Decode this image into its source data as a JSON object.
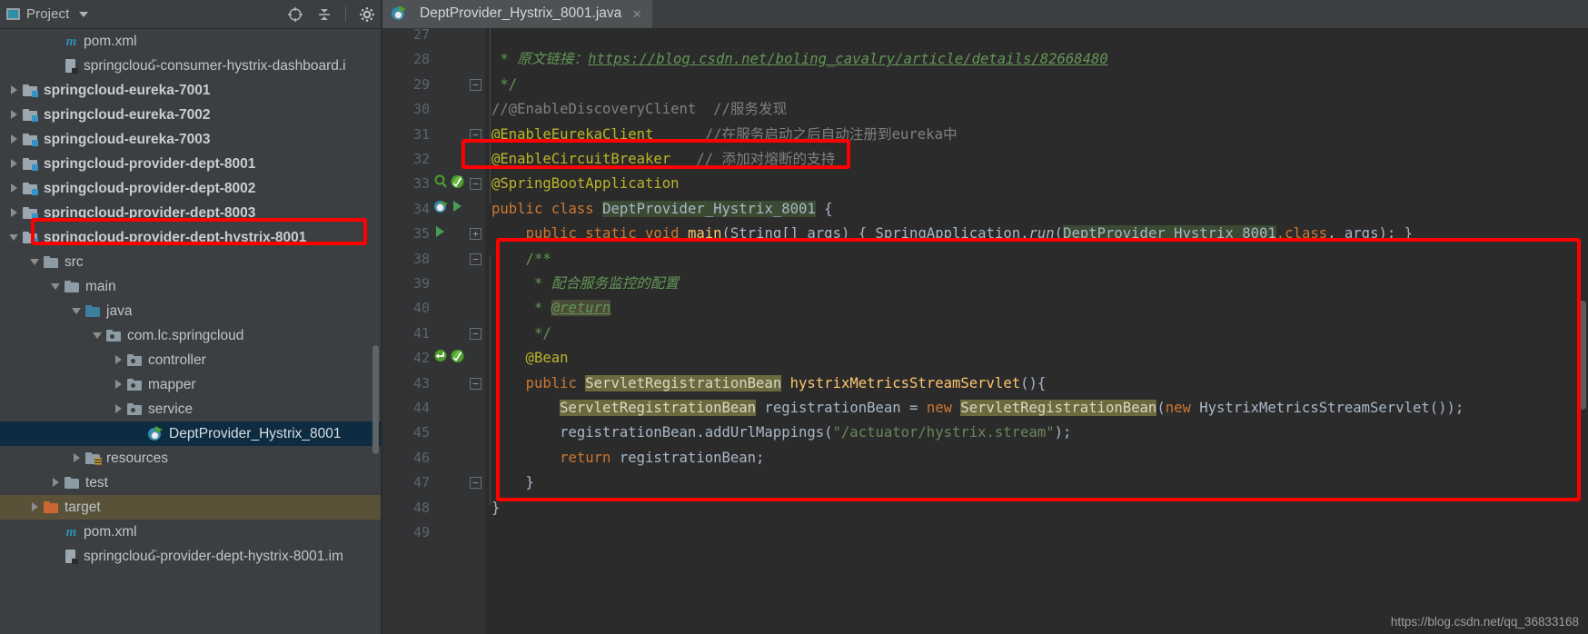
{
  "window": {
    "tool_window_title": "Project",
    "watermark": "https://blog.csdn.net/qq_36833168"
  },
  "toolbar": {
    "locate_icon": "crosshair-locate-icon",
    "collapse_icon": "collapse-all-icon",
    "settings_icon": "gear-icon",
    "hide_icon": "minimize-icon"
  },
  "sidebar": {
    "items": [
      {
        "label": "pom.xml",
        "icon": "maven-icon",
        "indent": 2,
        "arrow": "none",
        "style": "normal",
        "clipped": false
      },
      {
        "label": "springcloud-consumer-hystrix-dashboard.i",
        "icon": "iml-icon",
        "indent": 2,
        "arrow": "none",
        "style": "normal",
        "clipped": true
      },
      {
        "label": "springcloud-eureka-7001",
        "icon": "module-icon",
        "indent": 0,
        "arrow": "right",
        "style": "bold"
      },
      {
        "label": "springcloud-eureka-7002",
        "icon": "module-icon",
        "indent": 0,
        "arrow": "right",
        "style": "bold"
      },
      {
        "label": "springcloud-eureka-7003",
        "icon": "module-icon",
        "indent": 0,
        "arrow": "right",
        "style": "bold"
      },
      {
        "label": "springcloud-provider-dept-8001",
        "icon": "module-icon",
        "indent": 0,
        "arrow": "right",
        "style": "bold"
      },
      {
        "label": "springcloud-provider-dept-8002",
        "icon": "module-icon",
        "indent": 0,
        "arrow": "right",
        "style": "bold"
      },
      {
        "label": "springcloud-provider-dept-8003",
        "icon": "module-icon",
        "indent": 0,
        "arrow": "right",
        "style": "bold"
      },
      {
        "label": "springcloud-provider-dept-hystrix-8001",
        "icon": "module-icon",
        "indent": 0,
        "arrow": "down",
        "style": "bold",
        "highlight": "red-box"
      },
      {
        "label": "src",
        "icon": "folder-icon",
        "indent": 1,
        "arrow": "down",
        "style": "normal"
      },
      {
        "label": "main",
        "icon": "folder-icon",
        "indent": 2,
        "arrow": "down",
        "style": "normal"
      },
      {
        "label": "java",
        "icon": "folder-blue-icon",
        "indent": 3,
        "arrow": "down",
        "style": "normal"
      },
      {
        "label": "com.lc.springcloud",
        "icon": "package-icon",
        "indent": 4,
        "arrow": "down",
        "style": "normal"
      },
      {
        "label": "controller",
        "icon": "package-icon",
        "indent": 5,
        "arrow": "right",
        "style": "normal"
      },
      {
        "label": "mapper",
        "icon": "package-icon",
        "indent": 5,
        "arrow": "right",
        "style": "normal"
      },
      {
        "label": "service",
        "icon": "package-icon",
        "indent": 5,
        "arrow": "right",
        "style": "normal"
      },
      {
        "label": "DeptProvider_Hystrix_8001",
        "icon": "spring-class-icon",
        "indent": 6,
        "arrow": "none",
        "style": "normal",
        "selected": true
      },
      {
        "label": "resources",
        "icon": "resources-folder-icon",
        "indent": 3,
        "arrow": "right",
        "style": "normal"
      },
      {
        "label": "test",
        "icon": "folder-icon",
        "indent": 2,
        "arrow": "right",
        "style": "normal"
      },
      {
        "label": "target",
        "icon": "folder-orange-icon",
        "indent": 1,
        "arrow": "right",
        "style": "normal",
        "row_highlight": true
      },
      {
        "label": "pom.xml",
        "icon": "maven-icon",
        "indent": 2,
        "arrow": "none",
        "style": "normal"
      },
      {
        "label": "springcloud-provider-dept-hystrix-8001.im",
        "icon": "iml-icon",
        "indent": 2,
        "arrow": "none",
        "style": "normal",
        "clipped": true
      }
    ]
  },
  "editor": {
    "tab": {
      "title": "DeptProvider_Hystrix_8001.java",
      "icon": "spring-class-icon",
      "close": "×"
    },
    "lines": [
      {
        "num": "27",
        "text": "",
        "partial": true
      },
      {
        "num": "28",
        "segments": [
          {
            "t": " * ",
            "c": "jdoc"
          },
          {
            "t": "原文链接：",
            "c": "jdoc-i"
          },
          {
            "t": "https://blog.csdn.net/boling_cavalry/article/details/82668480",
            "c": "link"
          }
        ]
      },
      {
        "num": "29",
        "fold": "minus",
        "segments": [
          {
            "t": " */",
            "c": "jdoc"
          }
        ]
      },
      {
        "num": "30",
        "segments": [
          {
            "t": "//@EnableDiscoveryClient  //服务发现",
            "c": "cmt"
          }
        ]
      },
      {
        "num": "31",
        "fold": "minus",
        "segments": [
          {
            "t": "@EnableEurekaClient",
            "c": "anno"
          },
          {
            "t": "      //在服务启动之后自动注册到eureka中",
            "c": "cmt"
          }
        ]
      },
      {
        "num": "32",
        "segments": [
          {
            "t": "@EnableCircuitBreaker",
            "c": "anno"
          },
          {
            "t": "   // 添加对熔断的支持",
            "c": "cmt"
          }
        ]
      },
      {
        "num": "33",
        "gutter_icons": [
          "bean-search-icon",
          "spring-bean-icon"
        ],
        "fold": "minus",
        "segments": [
          {
            "t": "@SpringBootApplication",
            "c": "anno"
          }
        ]
      },
      {
        "num": "34",
        "gutter_icons": [
          "spring-class-icon",
          "run-icon"
        ],
        "segments": [
          {
            "t": "public ",
            "c": "kw"
          },
          {
            "t": "class ",
            "c": "kw"
          },
          {
            "t": "DeptProvider_Hystrix_8001",
            "c": "clsname"
          },
          {
            "t": " {",
            "c": "id"
          }
        ]
      },
      {
        "num": "35",
        "gutter_icons": [
          "run-icon"
        ],
        "fold": "plus",
        "segments": [
          {
            "t": "    ",
            "c": "id"
          },
          {
            "t": "public static void ",
            "c": "kw"
          },
          {
            "t": "main",
            "c": "meth"
          },
          {
            "t": "(String[] args) { SpringApplication.",
            "c": "id"
          },
          {
            "t": "run",
            "c": "methi"
          },
          {
            "t": "(",
            "c": "id"
          },
          {
            "t": "DeptProvider_Hystrix_8001",
            "c": "clsname"
          },
          {
            "t": ".class",
            "c": "kw"
          },
          {
            "t": ", args); }",
            "c": "id"
          }
        ]
      },
      {
        "num": "38",
        "fold": "minus",
        "segments": [
          {
            "t": "    /**",
            "c": "jdoc"
          }
        ]
      },
      {
        "num": "39",
        "segments": [
          {
            "t": "     * ",
            "c": "jdoc"
          },
          {
            "t": "配合服务监控的配置",
            "c": "jdoc-i"
          }
        ]
      },
      {
        "num": "40",
        "segments": [
          {
            "t": "     * ",
            "c": "jdoc"
          },
          {
            "t": "@return",
            "c": "jdoc-tag"
          }
        ]
      },
      {
        "num": "41",
        "fold": "minus",
        "segments": [
          {
            "t": "     */",
            "c": "jdoc"
          }
        ]
      },
      {
        "num": "42",
        "gutter_icons": [
          "override-icon",
          "spring-bean-icon"
        ],
        "segments": [
          {
            "t": "    @Bean",
            "c": "anno"
          }
        ]
      },
      {
        "num": "43",
        "fold": "minus",
        "segments": [
          {
            "t": "    ",
            "c": "id"
          },
          {
            "t": "public ",
            "c": "kw"
          },
          {
            "t": "ServletRegistrationBean",
            "c": "typ"
          },
          {
            "t": " ",
            "c": "id"
          },
          {
            "t": "hystrixMetricsStreamServlet",
            "c": "meth"
          },
          {
            "t": "(){",
            "c": "id"
          }
        ]
      },
      {
        "num": "44",
        "segments": [
          {
            "t": "        ",
            "c": "id"
          },
          {
            "t": "ServletRegistrationBean",
            "c": "typ"
          },
          {
            "t": " registrationBean = ",
            "c": "id"
          },
          {
            "t": "new ",
            "c": "kw"
          },
          {
            "t": "ServletRegistrationBean",
            "c": "typ"
          },
          {
            "t": "(",
            "c": "id"
          },
          {
            "t": "new ",
            "c": "kw"
          },
          {
            "t": "HystrixMetricsStreamServlet());",
            "c": "id"
          }
        ]
      },
      {
        "num": "45",
        "segments": [
          {
            "t": "        registrationBean.addUrlMappings(",
            "c": "id"
          },
          {
            "t": "\"/actuator/hystrix.stream\"",
            "c": "str"
          },
          {
            "t": ");",
            "c": "id"
          }
        ]
      },
      {
        "num": "46",
        "segments": [
          {
            "t": "        ",
            "c": "id"
          },
          {
            "t": "return ",
            "c": "kw"
          },
          {
            "t": "registrationBean;",
            "c": "id"
          }
        ]
      },
      {
        "num": "47",
        "fold": "minus",
        "segments": [
          {
            "t": "    }",
            "c": "id"
          }
        ]
      },
      {
        "num": "48",
        "segments": [
          {
            "t": "}",
            "c": "id"
          }
        ]
      },
      {
        "num": "49",
        "segments": [
          {
            "t": "",
            "c": "id"
          }
        ]
      }
    ]
  },
  "colors": {
    "annotation_red": "#ff0000",
    "sidebar_bg": "#3c3f41",
    "editor_bg": "#2b2b2b",
    "selection_blue": "#0d2b41",
    "target_highlight": "#5a5139"
  }
}
